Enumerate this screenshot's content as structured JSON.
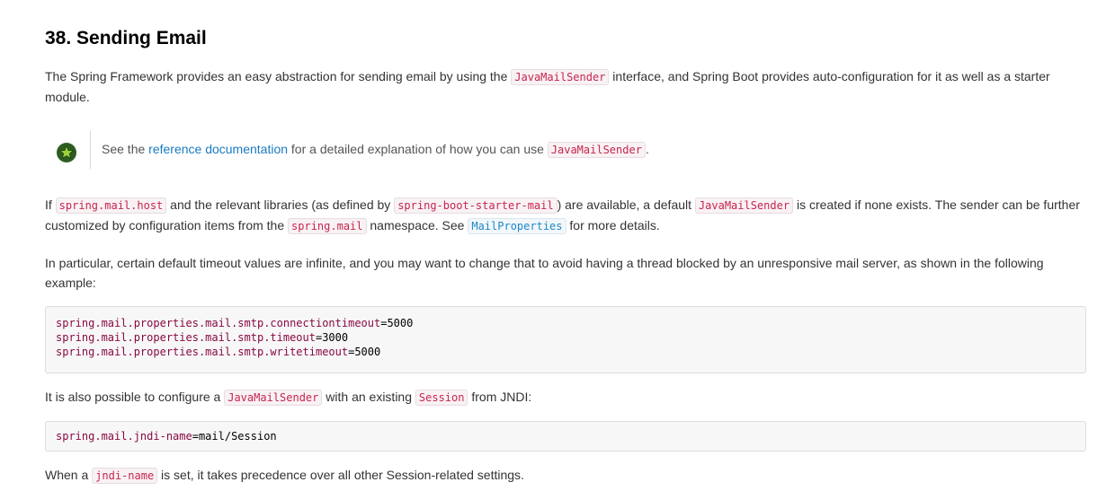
{
  "section": {
    "title": "38. Sending Email"
  },
  "intro": {
    "t1": "The Spring Framework provides an easy abstraction for sending email by using the ",
    "code1": "JavaMailSender",
    "t2": " interface, and Spring Boot provides auto-configuration for it as well as a starter module."
  },
  "tip": {
    "icon": "star-icon",
    "t1": "See the ",
    "link": "reference documentation",
    "t2": " for a detailed explanation of how you can use ",
    "code1": "JavaMailSender",
    "t3": "."
  },
  "para2": {
    "t1": "If ",
    "code1": "spring.mail.host",
    "t2": " and the relevant libraries (as defined by ",
    "code2": "spring-boot-starter-mail",
    "t3": ") are available, a default ",
    "code3": "JavaMailSender",
    "t4": " is created if none exists. The sender can be further customized by configuration items from the ",
    "code4": "spring.mail",
    "t5": " namespace. See ",
    "link_code": "MailProperties",
    "t6": " for more details."
  },
  "para3": {
    "text": "In particular, certain default timeout values are infinite, and you may want to change that to avoid having a thread blocked by an unresponsive mail server, as shown in the following example:"
  },
  "code_block_1": {
    "lines": [
      {
        "key": "spring.mail.properties.mail.smtp.connectiontimeout",
        "value": "=5000"
      },
      {
        "key": "spring.mail.properties.mail.smtp.timeout",
        "value": "=3000"
      },
      {
        "key": "spring.mail.properties.mail.smtp.writetimeout",
        "value": "=5000"
      }
    ]
  },
  "para4": {
    "t1": "It is also possible to configure a ",
    "code1": "JavaMailSender",
    "t2": " with an existing ",
    "code2": "Session",
    "t3": " from JNDI:"
  },
  "code_block_2": {
    "lines": [
      {
        "key": "spring.mail.jndi-name",
        "value": "=mail/Session"
      }
    ]
  },
  "para5": {
    "t1": "When a ",
    "code1": "jndi-name",
    "t2": " is set, it takes precedence over all other Session-related settings."
  },
  "colors": {
    "code_text": "#c7254e",
    "code_bg": "#f9f2f4",
    "link": "#1a7ac1",
    "property_key": "#880a43",
    "tip_icon_bg": "#2d5d1f",
    "tip_star": "#9bd23a"
  }
}
